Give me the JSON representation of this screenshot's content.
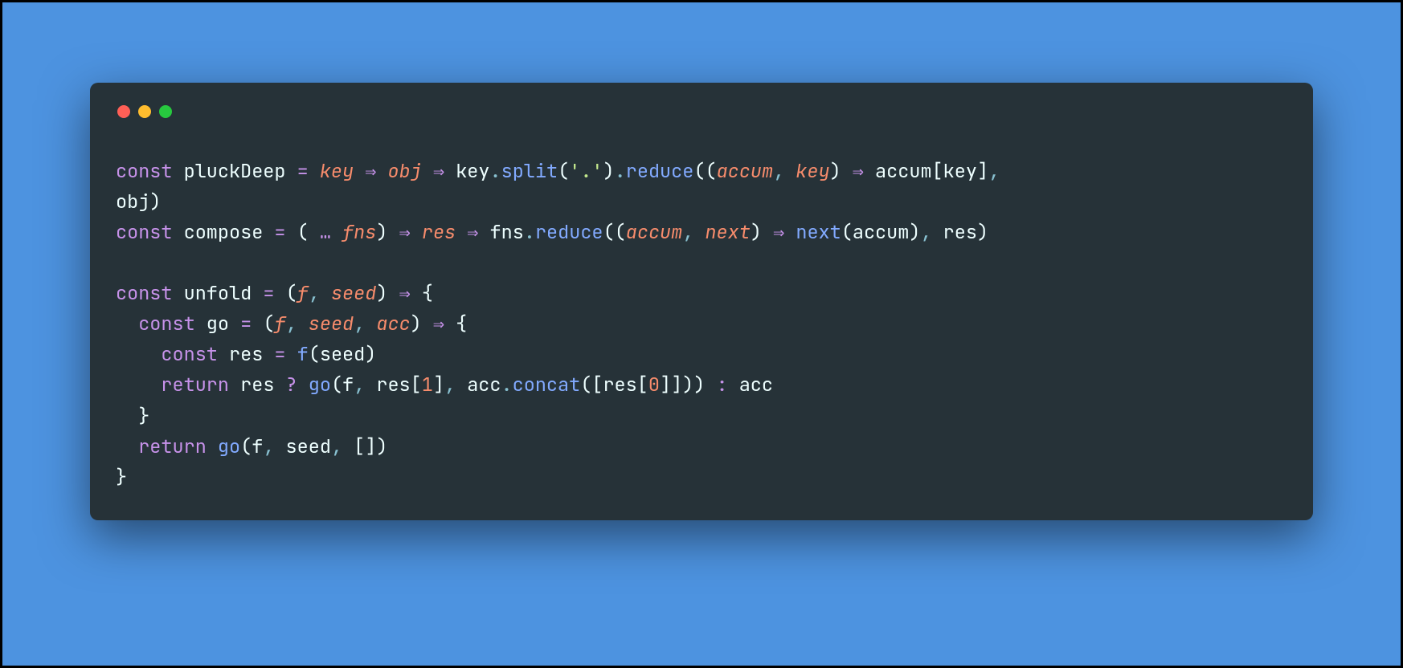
{
  "colors": {
    "background": "#4d93e0",
    "window": "#263238",
    "dot_red": "#ff5f56",
    "dot_yellow": "#ffbd2e",
    "dot_green": "#27c93f",
    "keyword": "#c792ea",
    "plain": "#eeffff",
    "method": "#82aaff",
    "param": "#f78c6c",
    "string": "#c3e88d",
    "number": "#f78c6c"
  },
  "code": {
    "lines": [
      [
        {
          "k": "kw",
          "t": "const"
        },
        {
          "k": "plain",
          "t": " pluckDeep "
        },
        {
          "k": "assign",
          "t": "="
        },
        {
          "k": "plain",
          "t": " "
        },
        {
          "k": "param",
          "t": "key"
        },
        {
          "k": "plain",
          "t": " "
        },
        {
          "k": "op",
          "t": "⇒"
        },
        {
          "k": "plain",
          "t": " "
        },
        {
          "k": "param",
          "t": "obj"
        },
        {
          "k": "plain",
          "t": " "
        },
        {
          "k": "op",
          "t": "⇒"
        },
        {
          "k": "plain",
          "t": " key"
        },
        {
          "k": "punct",
          "t": "."
        },
        {
          "k": "method",
          "t": "split"
        },
        {
          "k": "paren",
          "t": "("
        },
        {
          "k": "str",
          "t": "'.'"
        },
        {
          "k": "paren",
          "t": ")"
        },
        {
          "k": "punct",
          "t": "."
        },
        {
          "k": "method",
          "t": "reduce"
        },
        {
          "k": "paren",
          "t": "(("
        },
        {
          "k": "param",
          "t": "accum"
        },
        {
          "k": "punct",
          "t": ", "
        },
        {
          "k": "param",
          "t": "key"
        },
        {
          "k": "paren",
          "t": ")"
        },
        {
          "k": "plain",
          "t": " "
        },
        {
          "k": "op",
          "t": "⇒"
        },
        {
          "k": "plain",
          "t": " accum"
        },
        {
          "k": "paren",
          "t": "["
        },
        {
          "k": "plain",
          "t": "key"
        },
        {
          "k": "paren",
          "t": "]"
        },
        {
          "k": "punct",
          "t": ", "
        }
      ],
      [
        {
          "k": "plain",
          "t": "obj"
        },
        {
          "k": "paren",
          "t": ")"
        }
      ],
      [
        {
          "k": "kw",
          "t": "const"
        },
        {
          "k": "plain",
          "t": " compose "
        },
        {
          "k": "assign",
          "t": "="
        },
        {
          "k": "plain",
          "t": " "
        },
        {
          "k": "paren",
          "t": "("
        },
        {
          "k": "op",
          "t": " … "
        },
        {
          "k": "param",
          "t": "fns"
        },
        {
          "k": "paren",
          "t": ")"
        },
        {
          "k": "plain",
          "t": " "
        },
        {
          "k": "op",
          "t": "⇒"
        },
        {
          "k": "plain",
          "t": " "
        },
        {
          "k": "param",
          "t": "res"
        },
        {
          "k": "plain",
          "t": " "
        },
        {
          "k": "op",
          "t": "⇒"
        },
        {
          "k": "plain",
          "t": " fns"
        },
        {
          "k": "punct",
          "t": "."
        },
        {
          "k": "method",
          "t": "reduce"
        },
        {
          "k": "paren",
          "t": "(("
        },
        {
          "k": "param",
          "t": "accum"
        },
        {
          "k": "punct",
          "t": ", "
        },
        {
          "k": "param",
          "t": "next"
        },
        {
          "k": "paren",
          "t": ")"
        },
        {
          "k": "plain",
          "t": " "
        },
        {
          "k": "op",
          "t": "⇒"
        },
        {
          "k": "plain",
          "t": " "
        },
        {
          "k": "call",
          "t": "next"
        },
        {
          "k": "paren",
          "t": "("
        },
        {
          "k": "plain",
          "t": "accum"
        },
        {
          "k": "paren",
          "t": ")"
        },
        {
          "k": "punct",
          "t": ", "
        },
        {
          "k": "plain",
          "t": "res"
        },
        {
          "k": "paren",
          "t": ")"
        }
      ],
      [
        {
          "k": "plain",
          "t": ""
        }
      ],
      [
        {
          "k": "kw",
          "t": "const"
        },
        {
          "k": "plain",
          "t": " unfold "
        },
        {
          "k": "assign",
          "t": "="
        },
        {
          "k": "plain",
          "t": " "
        },
        {
          "k": "paren",
          "t": "("
        },
        {
          "k": "param",
          "t": "f"
        },
        {
          "k": "punct",
          "t": ", "
        },
        {
          "k": "param",
          "t": "seed"
        },
        {
          "k": "paren",
          "t": ")"
        },
        {
          "k": "plain",
          "t": " "
        },
        {
          "k": "op",
          "t": "⇒"
        },
        {
          "k": "plain",
          "t": " "
        },
        {
          "k": "paren",
          "t": "{"
        }
      ],
      [
        {
          "k": "plain",
          "t": "  "
        },
        {
          "k": "kw",
          "t": "const"
        },
        {
          "k": "plain",
          "t": " go "
        },
        {
          "k": "assign",
          "t": "="
        },
        {
          "k": "plain",
          "t": " "
        },
        {
          "k": "paren",
          "t": "("
        },
        {
          "k": "param",
          "t": "f"
        },
        {
          "k": "punct",
          "t": ", "
        },
        {
          "k": "param",
          "t": "seed"
        },
        {
          "k": "punct",
          "t": ", "
        },
        {
          "k": "param",
          "t": "acc"
        },
        {
          "k": "paren",
          "t": ")"
        },
        {
          "k": "plain",
          "t": " "
        },
        {
          "k": "op",
          "t": "⇒"
        },
        {
          "k": "plain",
          "t": " "
        },
        {
          "k": "paren",
          "t": "{"
        }
      ],
      [
        {
          "k": "plain",
          "t": "    "
        },
        {
          "k": "kw",
          "t": "const"
        },
        {
          "k": "plain",
          "t": " res "
        },
        {
          "k": "assign",
          "t": "="
        },
        {
          "k": "plain",
          "t": " "
        },
        {
          "k": "call",
          "t": "f"
        },
        {
          "k": "paren",
          "t": "("
        },
        {
          "k": "plain",
          "t": "seed"
        },
        {
          "k": "paren",
          "t": ")"
        }
      ],
      [
        {
          "k": "plain",
          "t": "    "
        },
        {
          "k": "kw",
          "t": "return"
        },
        {
          "k": "plain",
          "t": " res "
        },
        {
          "k": "op",
          "t": "?"
        },
        {
          "k": "plain",
          "t": " "
        },
        {
          "k": "call",
          "t": "go"
        },
        {
          "k": "paren",
          "t": "("
        },
        {
          "k": "plain",
          "t": "f"
        },
        {
          "k": "punct",
          "t": ", "
        },
        {
          "k": "plain",
          "t": "res"
        },
        {
          "k": "paren",
          "t": "["
        },
        {
          "k": "num",
          "t": "1"
        },
        {
          "k": "paren",
          "t": "]"
        },
        {
          "k": "punct",
          "t": ", "
        },
        {
          "k": "plain",
          "t": "acc"
        },
        {
          "k": "punct",
          "t": "."
        },
        {
          "k": "method",
          "t": "concat"
        },
        {
          "k": "paren",
          "t": "(["
        },
        {
          "k": "plain",
          "t": "res"
        },
        {
          "k": "paren",
          "t": "["
        },
        {
          "k": "num",
          "t": "0"
        },
        {
          "k": "paren",
          "t": "]]))"
        },
        {
          "k": "plain",
          "t": " "
        },
        {
          "k": "op",
          "t": ":"
        },
        {
          "k": "plain",
          "t": " acc"
        }
      ],
      [
        {
          "k": "plain",
          "t": "  "
        },
        {
          "k": "paren",
          "t": "}"
        }
      ],
      [
        {
          "k": "plain",
          "t": "  "
        },
        {
          "k": "kw",
          "t": "return"
        },
        {
          "k": "plain",
          "t": " "
        },
        {
          "k": "call",
          "t": "go"
        },
        {
          "k": "paren",
          "t": "("
        },
        {
          "k": "plain",
          "t": "f"
        },
        {
          "k": "punct",
          "t": ", "
        },
        {
          "k": "plain",
          "t": "seed"
        },
        {
          "k": "punct",
          "t": ", "
        },
        {
          "k": "paren",
          "t": "[])"
        }
      ],
      [
        {
          "k": "paren",
          "t": "}"
        }
      ]
    ]
  }
}
